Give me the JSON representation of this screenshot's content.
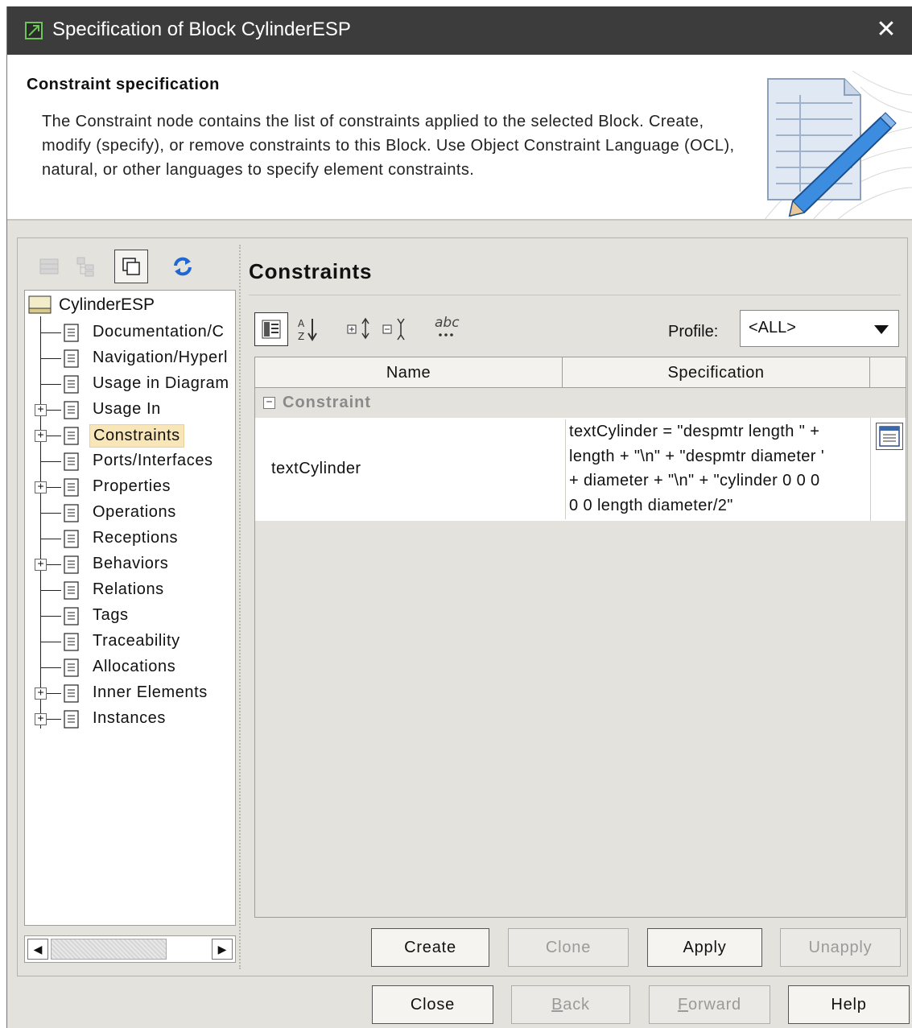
{
  "window": {
    "title": "Specification of Block CylinderESP",
    "close_symbol": "✕"
  },
  "header": {
    "title": "Constraint specification",
    "description": "The Constraint node contains the list of constraints applied to the selected Block. Create, modify (specify), or remove constraints to this Block. Use Object Constraint Language (OCL), natural, or other languages to specify element constraints."
  },
  "tree": {
    "root": "CylinderESP",
    "items": [
      {
        "label": "Documentation/C",
        "expandable": false
      },
      {
        "label": "Navigation/Hyperl",
        "expandable": false
      },
      {
        "label": "Usage in Diagram",
        "expandable": false
      },
      {
        "label": "Usage In",
        "expandable": true
      },
      {
        "label": "Constraints",
        "expandable": true,
        "selected": true
      },
      {
        "label": "Ports/Interfaces",
        "expandable": false
      },
      {
        "label": "Properties",
        "expandable": true
      },
      {
        "label": "Operations",
        "expandable": false
      },
      {
        "label": "Receptions",
        "expandable": false
      },
      {
        "label": "Behaviors",
        "expandable": true
      },
      {
        "label": "Relations",
        "expandable": false
      },
      {
        "label": "Tags",
        "expandable": false
      },
      {
        "label": "Traceability",
        "expandable": false
      },
      {
        "label": "Allocations",
        "expandable": false
      },
      {
        "label": "Inner Elements",
        "expandable": true
      },
      {
        "label": "Instances",
        "expandable": true
      }
    ]
  },
  "panel": {
    "title": "Constraints",
    "profile_label": "Profile:",
    "profile_value": "<ALL>",
    "toolbar_abc": "abc"
  },
  "grid": {
    "columns": [
      "Name",
      "Specification"
    ],
    "group": "Constraint",
    "rows": [
      {
        "name": "textCylinder",
        "specification": "textCylinder = \"despmtr length \" +\nlength + \"\\n\" + \"despmtr diameter '\n+ diameter + \"\\n\" + \"cylinder 0 0 0\n0 0 length diameter/2\""
      }
    ]
  },
  "actions": {
    "create": "Create",
    "clone": "Clone",
    "apply": "Apply",
    "unapply": "Unapply"
  },
  "footer": {
    "close": "Close",
    "back_mnemonic": "B",
    "back_rest": "ack",
    "forward_mnemonic": "F",
    "forward_rest": "orward",
    "help": "Help"
  },
  "colors": {
    "titlebar": "#3c3c3c",
    "selection": "#f8e6b8",
    "accent_blue": "#1f67d2"
  }
}
